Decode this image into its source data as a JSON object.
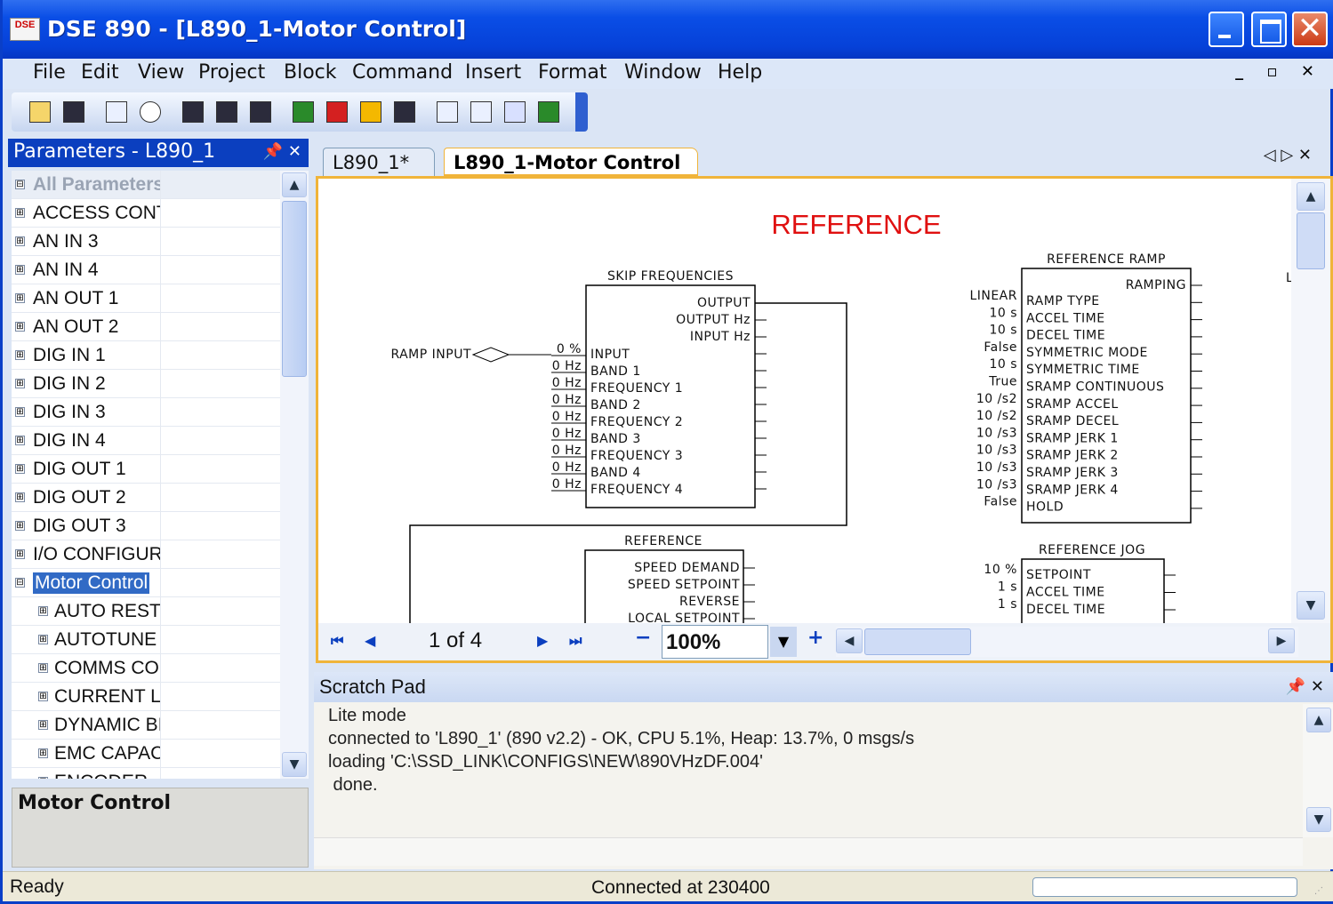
{
  "window": {
    "title": "DSE 890 - [L890_1-Motor Control]",
    "icon_text": "DSE",
    "accent": "#0b3fbf"
  },
  "menu": [
    "File",
    "Edit",
    "View",
    "Project",
    "Block",
    "Command",
    "Insert",
    "Format",
    "Window",
    "Help"
  ],
  "mdi_controls": "_ ▫ ✕",
  "params": {
    "title": "Parameters - L890_1",
    "items": [
      {
        "label": "All Parameters",
        "exp": "⊟",
        "level": 0,
        "style": "gray"
      },
      {
        "label": "ACCESS CONT",
        "exp": "⊞",
        "level": 0
      },
      {
        "label": "AN IN 3",
        "exp": "⊞",
        "level": 0
      },
      {
        "label": "AN IN 4",
        "exp": "⊞",
        "level": 0
      },
      {
        "label": "AN OUT 1",
        "exp": "⊞",
        "level": 0
      },
      {
        "label": "AN OUT 2",
        "exp": "⊞",
        "level": 0
      },
      {
        "label": "DIG IN 1",
        "exp": "⊞",
        "level": 0
      },
      {
        "label": "DIG IN 2",
        "exp": "⊞",
        "level": 0
      },
      {
        "label": "DIG IN 3",
        "exp": "⊞",
        "level": 0
      },
      {
        "label": "DIG IN 4",
        "exp": "⊞",
        "level": 0
      },
      {
        "label": "DIG OUT 1",
        "exp": "⊞",
        "level": 0
      },
      {
        "label": "DIG OUT 2",
        "exp": "⊞",
        "level": 0
      },
      {
        "label": "DIG OUT 3",
        "exp": "⊞",
        "level": 0
      },
      {
        "label": "I/O CONFIGUR",
        "exp": "⊞",
        "level": 0
      },
      {
        "label": "Motor Control",
        "exp": "⊟",
        "level": 0,
        "style": "sel"
      },
      {
        "label": "AUTO REST",
        "exp": "⊞",
        "level": 1
      },
      {
        "label": "AUTOTUNE",
        "exp": "⊞",
        "level": 1
      },
      {
        "label": "COMMS COI",
        "exp": "⊞",
        "level": 1
      },
      {
        "label": "CURRENT L",
        "exp": "⊞",
        "level": 1
      },
      {
        "label": "DYNAMIC BI",
        "exp": "⊞",
        "level": 1
      },
      {
        "label": "EMC CAPAC",
        "exp": "⊞",
        "level": 1
      },
      {
        "label": "ENCODER",
        "exp": "⊞",
        "level": 1
      }
    ],
    "description": "Motor Control"
  },
  "tabs": [
    {
      "label": "L890_1*"
    },
    {
      "label": "L890_1-Motor Control"
    }
  ],
  "diagram": {
    "title": "REFERENCE",
    "title_color": "#e01010",
    "skip": {
      "title": "SKIP FREQUENCIES",
      "outputs": [
        "OUTPUT",
        "OUTPUT Hz",
        "INPUT Hz"
      ],
      "inputs": [
        {
          "v": "0 %",
          "l": "INPUT"
        },
        {
          "v": "0 Hz",
          "l": "BAND 1"
        },
        {
          "v": "0 Hz",
          "l": "FREQUENCY 1"
        },
        {
          "v": "0 Hz",
          "l": "BAND 2"
        },
        {
          "v": "0 Hz",
          "l": "FREQUENCY 2"
        },
        {
          "v": "0 Hz",
          "l": "BAND 3"
        },
        {
          "v": "0 Hz",
          "l": "FREQUENCY 3"
        },
        {
          "v": "0 Hz",
          "l": "BAND 4"
        },
        {
          "v": "0 Hz",
          "l": "FREQUENCY 4"
        }
      ],
      "ramp_input": "RAMP INPUT"
    },
    "ramp": {
      "title": "REFERENCE RAMP",
      "output": "RAMPING",
      "inputs": [
        {
          "v": "LINEAR",
          "l": "RAMP TYPE"
        },
        {
          "v": "10 s",
          "l": "ACCEL TIME"
        },
        {
          "v": "10 s",
          "l": "DECEL TIME"
        },
        {
          "v": "False",
          "l": "SYMMETRIC MODE"
        },
        {
          "v": "10 s",
          "l": "SYMMETRIC TIME"
        },
        {
          "v": "True",
          "l": "SRAMP CONTINUOUS"
        },
        {
          "v": "10 /s2",
          "l": "SRAMP ACCEL"
        },
        {
          "v": "10 /s2",
          "l": "SRAMP DECEL"
        },
        {
          "v": "10 /s3",
          "l": "SRAMP JERK 1"
        },
        {
          "v": "10 /s3",
          "l": "SRAMP JERK 2"
        },
        {
          "v": "10 /s3",
          "l": "SRAMP JERK 3"
        },
        {
          "v": "10 /s3",
          "l": "SRAMP JERK 4"
        },
        {
          "v": "False",
          "l": "HOLD"
        }
      ]
    },
    "reference": {
      "title": "REFERENCE",
      "outputs": [
        "SPEED DEMAND",
        "SPEED SETPOINT",
        "REVERSE",
        "LOCAL SETPOINT"
      ]
    },
    "jog": {
      "title": "REFERENCE JOG",
      "inputs": [
        {
          "v": "10 %",
          "l": "SETPOINT"
        },
        {
          "v": "1 s",
          "l": "ACCEL TIME"
        },
        {
          "v": "1 s",
          "l": "DECEL TIME"
        }
      ]
    },
    "edge_char": "L"
  },
  "nav": {
    "page": "1 of 4",
    "zoom": "100%"
  },
  "scratch": {
    "title": "Scratch Pad",
    "lines": [
      "Lite mode",
      "connected to 'L890_1' (890 v2.2) - OK, CPU 5.1%, Heap: 13.7%, 0 msgs/s",
      "loading 'C:\\SSD_LINK\\CONFIGS\\NEW\\890VHzDF.004'",
      " done."
    ]
  },
  "status": {
    "left": "Ready",
    "middle": "Connected at 230400"
  }
}
